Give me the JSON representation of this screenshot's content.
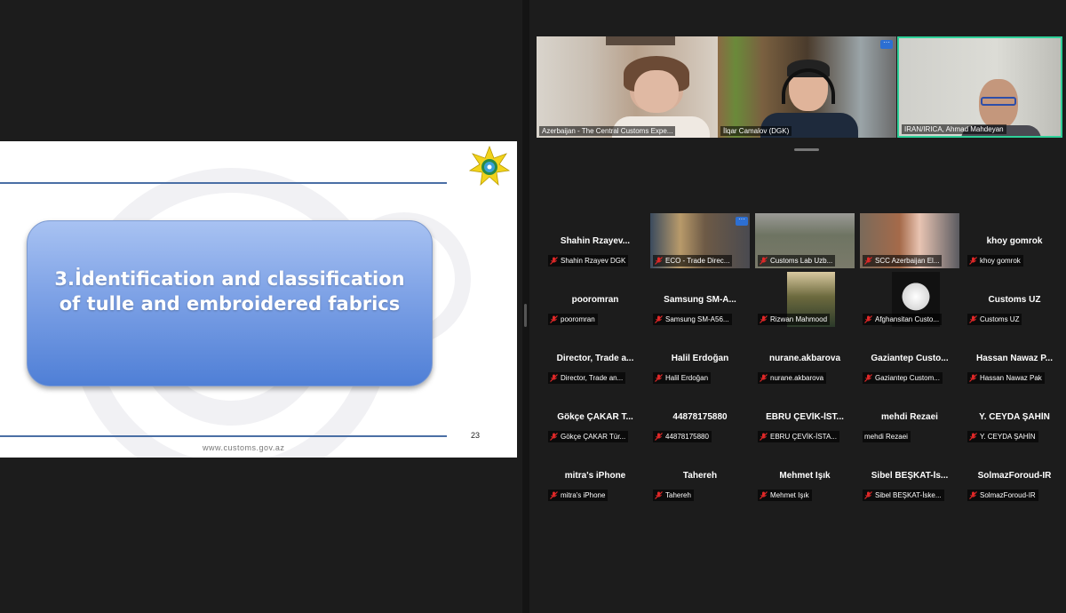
{
  "slide": {
    "title": "3.İdentification and classification of tulle and embroidered fabrics",
    "page": "23",
    "url": "www.customs.gov.az"
  },
  "top_videos": [
    {
      "label": "Azerbaijan - The Central Customs Expe..."
    },
    {
      "label": "İlqar Camalov (DGK)"
    },
    {
      "label": "IRAN/IRICA, Ahmad Mahdeyan"
    }
  ],
  "more_icon": "···",
  "participants": [
    {
      "name": "Shahin  Rzayev...",
      "label": "Shahin Rzayev DGK",
      "video": false
    },
    {
      "name": "",
      "label": "ECO - Trade Direc...",
      "video": true
    },
    {
      "name": "",
      "label": "Customs Lab Uzb...",
      "video": true
    },
    {
      "name": "",
      "label": "SCC Azerbaijan El...",
      "video": true
    },
    {
      "name": "khoy gomrok",
      "label": "khoy gomrok",
      "video": false
    },
    {
      "name": "pooromran",
      "label": "pooromran",
      "video": false
    },
    {
      "name": "Samsung  SM-A...",
      "label": "Samsung SM-A56...",
      "video": false
    },
    {
      "name": "",
      "label": "Rizwan Mahmood",
      "video": true
    },
    {
      "name": "",
      "label": "Afghansitan Custo...",
      "video": true
    },
    {
      "name": "Customs UZ",
      "label": "Customs UZ",
      "video": false
    },
    {
      "name": "Director,  Trade a...",
      "label": "Director, Trade an...",
      "video": false
    },
    {
      "name": "Halil Erdoğan",
      "label": "Halil Erdoğan",
      "video": false
    },
    {
      "name": "nurane.akbarova",
      "label": "nurane.akbarova",
      "video": false
    },
    {
      "name": "Gaziantep  Custo...",
      "label": "Gaziantep Custom...",
      "video": false
    },
    {
      "name": "Hassan Nawaz P...",
      "label": "Hassan Nawaz Pak",
      "video": false
    },
    {
      "name": "Gökçe ÇAKAR T...",
      "label": "Gökçe ÇAKAR Tür...",
      "video": false
    },
    {
      "name": "44878175880",
      "label": "44878175880",
      "video": false
    },
    {
      "name": "EBRU ÇEVİK-İST...",
      "label": "EBRU ÇEVİK-İSTA...",
      "video": false
    },
    {
      "name": "mehdi Rezaei",
      "label": "mehdi Rezaei",
      "video": false,
      "nomic": true
    },
    {
      "name": "Y. CEYDA ŞAHİN",
      "label": "Y. CEYDA ŞAHİN",
      "video": false
    },
    {
      "name": "mitra's iPhone",
      "label": "mitra's iPhone",
      "video": false
    },
    {
      "name": "Tahereh",
      "label": "Tahereh",
      "video": false
    },
    {
      "name": "Mehmet Işık",
      "label": "Mehmet Işık",
      "video": false
    },
    {
      "name": "Sibel  BEŞKAT-İs...",
      "label": "Sibel BEŞKAT-İske...",
      "video": false
    },
    {
      "name": "SolmazForoud-IR",
      "label": "SolmazForoud-IR",
      "video": false
    }
  ],
  "colors": {
    "mic_muted": "#e02828",
    "active_speaker_border": "#2fd19a",
    "slide_box": "#7ea2e6"
  }
}
